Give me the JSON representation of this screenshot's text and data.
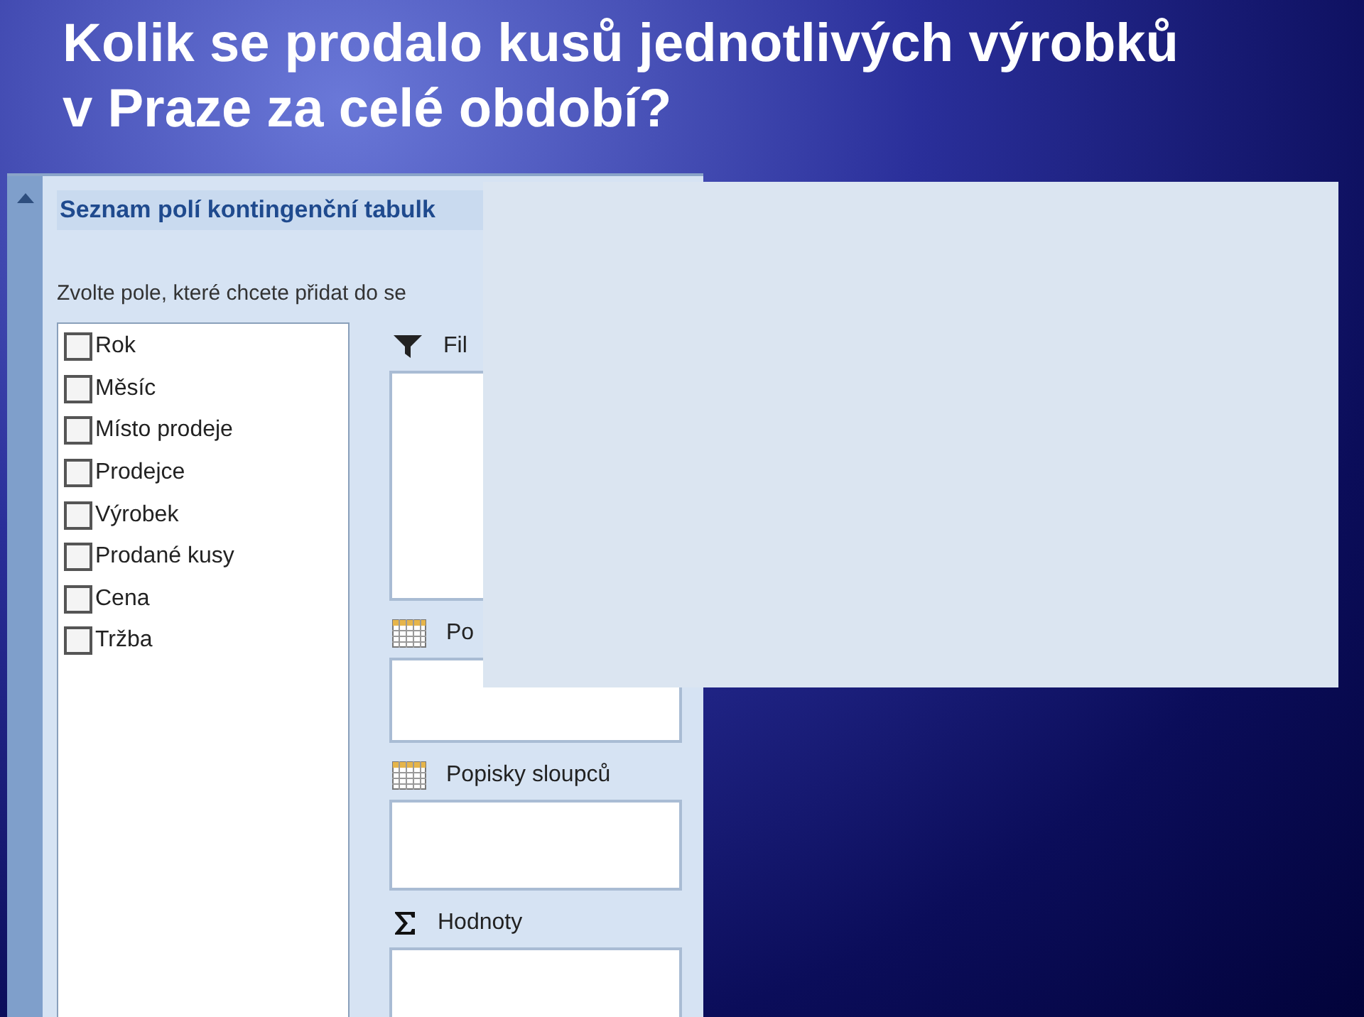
{
  "slide": {
    "title_lines": [
      "Kolik se prodalo kusů jednotlivých výrobků",
      "v Praze za celé období?"
    ]
  },
  "field_list": {
    "title": "Seznam polí kontingenční tabulk",
    "instruction": "Zvolte pole, které chcete přidat do se",
    "fields": [
      {
        "label": "Rok",
        "checked": false
      },
      {
        "label": "Měsíc",
        "checked": false
      },
      {
        "label": "Místo prodeje",
        "checked": false
      },
      {
        "label": "Prodejce",
        "checked": false
      },
      {
        "label": "Výrobek",
        "checked": false
      },
      {
        "label": "Prodané kusy",
        "checked": false
      },
      {
        "label": "Cena",
        "checked": false
      },
      {
        "label": "Tržba",
        "checked": false
      }
    ],
    "areas": [
      {
        "kind": "filter",
        "label": "Fil"
      },
      {
        "kind": "rows",
        "label": "Po"
      },
      {
        "kind": "columns",
        "label": "Popisky sloupců"
      },
      {
        "kind": "values",
        "label": "Hodnoty"
      }
    ]
  }
}
